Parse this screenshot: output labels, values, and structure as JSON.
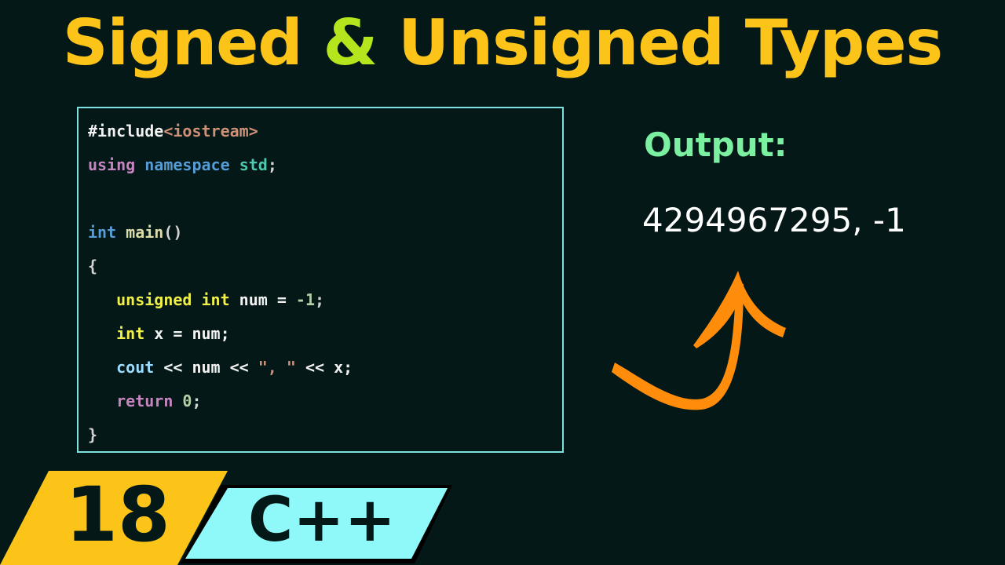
{
  "title": {
    "part1": "Signed ",
    "amp": "&",
    "part2": " Unsigned Types"
  },
  "code": {
    "lines": [
      {
        "include": "#include",
        "header": "<iostream>"
      },
      {
        "using": "using",
        "namespace": "namespace",
        "std": "std",
        "semi": ";"
      },
      {},
      {
        "type": "int",
        "fn": "main",
        "parens": "()"
      },
      {
        "brace": "{"
      },
      {
        "kw1": "unsigned",
        "kw2": "int",
        "rest": "num = ",
        "num": "-1",
        "semi": ";"
      },
      {
        "kw": "int",
        "rest": "x = num;"
      },
      {
        "cout": "cout",
        "rest1": "<< num << ",
        "str": "\", \"",
        "rest2": " << x;"
      },
      {
        "kw": "return",
        "num": "0",
        "semi": ";"
      },
      {
        "brace": "}"
      }
    ]
  },
  "output": {
    "label": "Output:",
    "value": "4294967295, -1"
  },
  "badges": {
    "episode": "18",
    "language": "C++"
  },
  "colors": {
    "background": "#031817",
    "title": "#fcc419",
    "ampersand": "#b5e61d",
    "output_label": "#7af0a0",
    "arrow": "#ff8c0a",
    "episode_badge": "#fcc419",
    "language_badge": "#8ff8f8",
    "code_border": "#7fe0e0"
  }
}
